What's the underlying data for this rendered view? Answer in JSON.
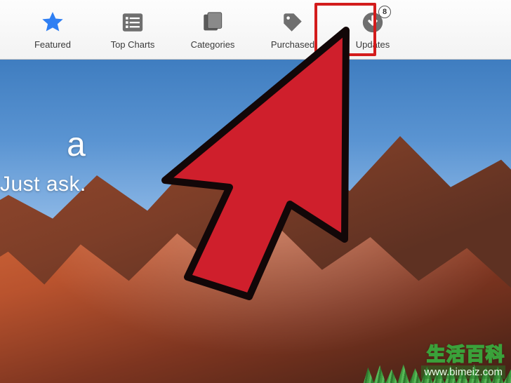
{
  "toolbar": {
    "tabs": [
      {
        "id": "featured",
        "label": "Featured",
        "icon": "star-icon",
        "active": true
      },
      {
        "id": "topcharts",
        "label": "Top Charts",
        "icon": "list-icon",
        "active": false
      },
      {
        "id": "categories",
        "label": "Categories",
        "icon": "categories-icon",
        "active": false
      },
      {
        "id": "purchased",
        "label": "Purchased",
        "icon": "tag-icon",
        "active": false
      },
      {
        "id": "updates",
        "label": "Updates",
        "icon": "updates-icon",
        "active": false,
        "badge": "8"
      }
    ]
  },
  "hero": {
    "line1_partial": "a",
    "line2_partial": "Just ask."
  },
  "highlight": {
    "target_tab": "updates",
    "color": "#d31c1c"
  },
  "watermark": {
    "brand": "生活百科",
    "url": "www.bimeiz.com"
  }
}
